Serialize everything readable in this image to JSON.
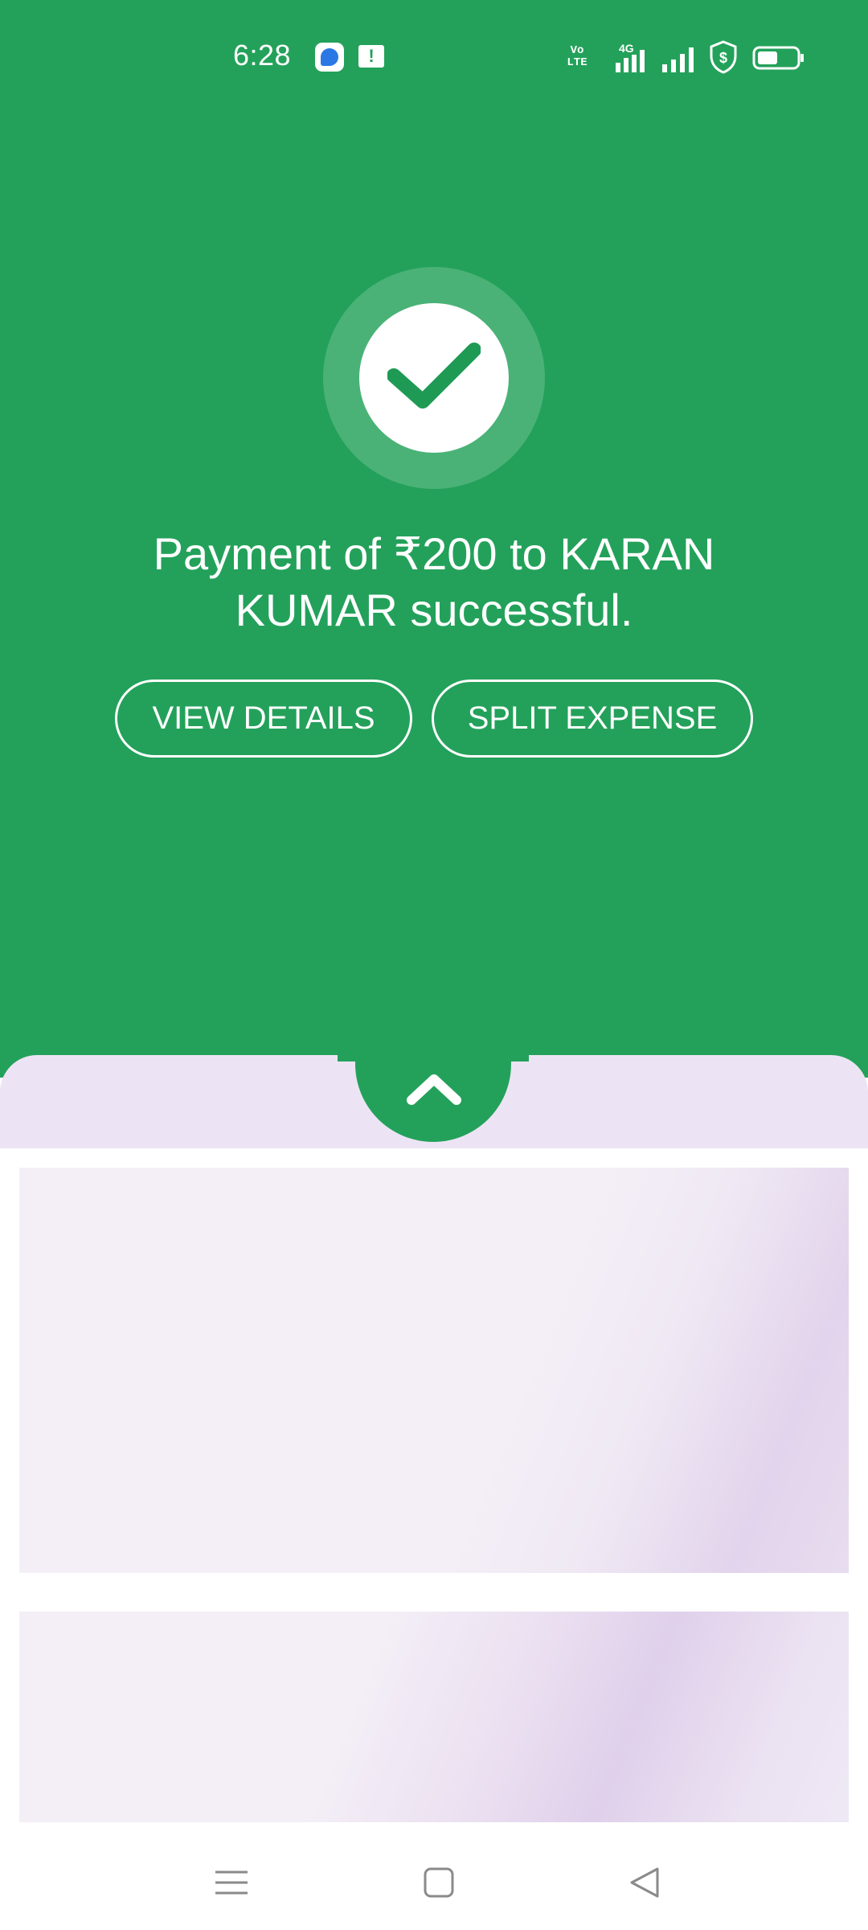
{
  "status_bar": {
    "time": "6:28",
    "volte_label": "Vo LTE",
    "network_label": "4G"
  },
  "success": {
    "message": "Payment of ₹200 to KARAN KUMAR successful."
  },
  "actions": {
    "view_details_label": "VIEW DETAILS",
    "split_expense_label": "SPLIT EXPENSE"
  },
  "colors": {
    "primary_green": "#23a15a",
    "sheet_bg": "#ece4f4",
    "card_bg": "#f4eff7"
  }
}
